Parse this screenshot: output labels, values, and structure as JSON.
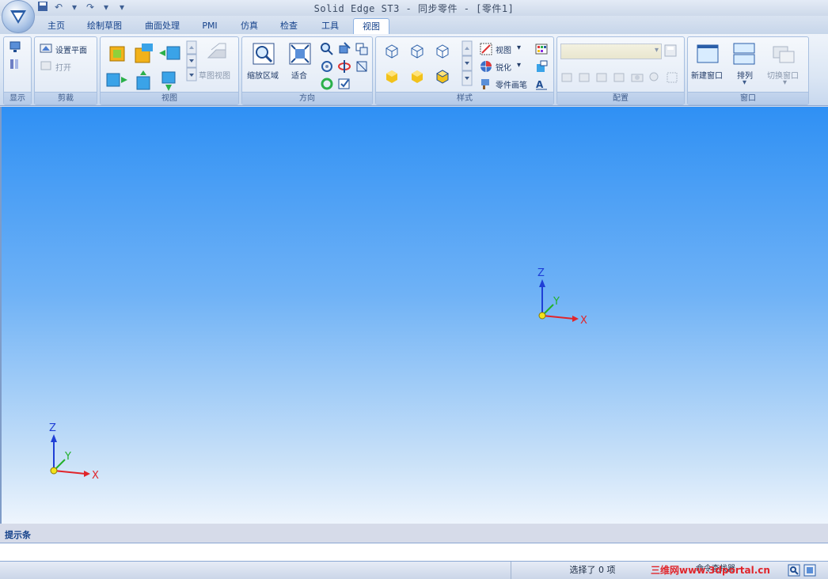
{
  "window": {
    "title": "Solid Edge ST3 - 同步零件 - [零件1]"
  },
  "tabs": [
    {
      "label": "主页"
    },
    {
      "label": "绘制草图"
    },
    {
      "label": "曲面处理"
    },
    {
      "label": "PMI"
    },
    {
      "label": "仿真"
    },
    {
      "label": "检查"
    },
    {
      "label": "工具"
    },
    {
      "label": "视图",
      "active": true
    }
  ],
  "ribbon": {
    "groups": {
      "display": "显示",
      "clip": "剪裁",
      "views": "视图",
      "orient": "方向",
      "style": "样式",
      "config": "配置",
      "window": "窗口"
    },
    "clip": {
      "set_plane": "设置平面",
      "open": "打开"
    },
    "views": {
      "sketch_view": "草图视图"
    },
    "orient": {
      "zoom_area": "缩放区域",
      "fit": "适合"
    },
    "style": {
      "view": "视图",
      "sharpen": "锐化",
      "part_painter": "零件画笔"
    },
    "window": {
      "new_window": "新建窗口",
      "arrange": "排列",
      "switch_window": "切换窗口"
    }
  },
  "axes": {
    "x": "X",
    "y": "Y",
    "z": "Z"
  },
  "hint_bar": {
    "label": "提示条"
  },
  "status": {
    "selection": "选择了 0 项",
    "command_finder": "命令查找器"
  },
  "watermark": {
    "text": "三维网www.3dportal.cn"
  },
  "colors": {
    "accent": "#15428b",
    "x_axis": "#e0252b",
    "y_axis": "#22b02a",
    "z_axis": "#1f3fd6"
  }
}
